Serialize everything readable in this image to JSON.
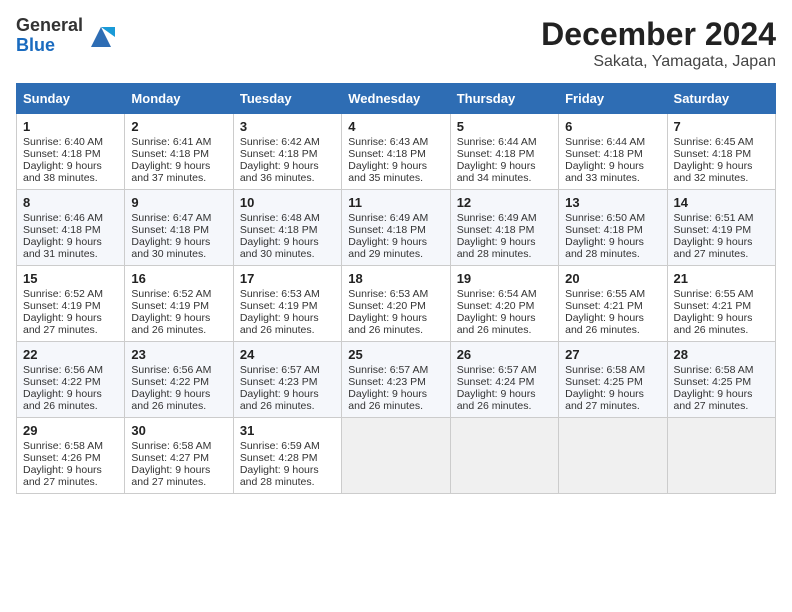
{
  "logo": {
    "general": "General",
    "blue": "Blue"
  },
  "title": "December 2024",
  "subtitle": "Sakata, Yamagata, Japan",
  "weekdays": [
    "Sunday",
    "Monday",
    "Tuesday",
    "Wednesday",
    "Thursday",
    "Friday",
    "Saturday"
  ],
  "weeks": [
    [
      {
        "day": 1,
        "sunrise": "Sunrise: 6:40 AM",
        "sunset": "Sunset: 4:18 PM",
        "daylight": "Daylight: 9 hours and 38 minutes."
      },
      {
        "day": 2,
        "sunrise": "Sunrise: 6:41 AM",
        "sunset": "Sunset: 4:18 PM",
        "daylight": "Daylight: 9 hours and 37 minutes."
      },
      {
        "day": 3,
        "sunrise": "Sunrise: 6:42 AM",
        "sunset": "Sunset: 4:18 PM",
        "daylight": "Daylight: 9 hours and 36 minutes."
      },
      {
        "day": 4,
        "sunrise": "Sunrise: 6:43 AM",
        "sunset": "Sunset: 4:18 PM",
        "daylight": "Daylight: 9 hours and 35 minutes."
      },
      {
        "day": 5,
        "sunrise": "Sunrise: 6:44 AM",
        "sunset": "Sunset: 4:18 PM",
        "daylight": "Daylight: 9 hours and 34 minutes."
      },
      {
        "day": 6,
        "sunrise": "Sunrise: 6:44 AM",
        "sunset": "Sunset: 4:18 PM",
        "daylight": "Daylight: 9 hours and 33 minutes."
      },
      {
        "day": 7,
        "sunrise": "Sunrise: 6:45 AM",
        "sunset": "Sunset: 4:18 PM",
        "daylight": "Daylight: 9 hours and 32 minutes."
      }
    ],
    [
      {
        "day": 8,
        "sunrise": "Sunrise: 6:46 AM",
        "sunset": "Sunset: 4:18 PM",
        "daylight": "Daylight: 9 hours and 31 minutes."
      },
      {
        "day": 9,
        "sunrise": "Sunrise: 6:47 AM",
        "sunset": "Sunset: 4:18 PM",
        "daylight": "Daylight: 9 hours and 30 minutes."
      },
      {
        "day": 10,
        "sunrise": "Sunrise: 6:48 AM",
        "sunset": "Sunset: 4:18 PM",
        "daylight": "Daylight: 9 hours and 30 minutes."
      },
      {
        "day": 11,
        "sunrise": "Sunrise: 6:49 AM",
        "sunset": "Sunset: 4:18 PM",
        "daylight": "Daylight: 9 hours and 29 minutes."
      },
      {
        "day": 12,
        "sunrise": "Sunrise: 6:49 AM",
        "sunset": "Sunset: 4:18 PM",
        "daylight": "Daylight: 9 hours and 28 minutes."
      },
      {
        "day": 13,
        "sunrise": "Sunrise: 6:50 AM",
        "sunset": "Sunset: 4:18 PM",
        "daylight": "Daylight: 9 hours and 28 minutes."
      },
      {
        "day": 14,
        "sunrise": "Sunrise: 6:51 AM",
        "sunset": "Sunset: 4:19 PM",
        "daylight": "Daylight: 9 hours and 27 minutes."
      }
    ],
    [
      {
        "day": 15,
        "sunrise": "Sunrise: 6:52 AM",
        "sunset": "Sunset: 4:19 PM",
        "daylight": "Daylight: 9 hours and 27 minutes."
      },
      {
        "day": 16,
        "sunrise": "Sunrise: 6:52 AM",
        "sunset": "Sunset: 4:19 PM",
        "daylight": "Daylight: 9 hours and 26 minutes."
      },
      {
        "day": 17,
        "sunrise": "Sunrise: 6:53 AM",
        "sunset": "Sunset: 4:19 PM",
        "daylight": "Daylight: 9 hours and 26 minutes."
      },
      {
        "day": 18,
        "sunrise": "Sunrise: 6:53 AM",
        "sunset": "Sunset: 4:20 PM",
        "daylight": "Daylight: 9 hours and 26 minutes."
      },
      {
        "day": 19,
        "sunrise": "Sunrise: 6:54 AM",
        "sunset": "Sunset: 4:20 PM",
        "daylight": "Daylight: 9 hours and 26 minutes."
      },
      {
        "day": 20,
        "sunrise": "Sunrise: 6:55 AM",
        "sunset": "Sunset: 4:21 PM",
        "daylight": "Daylight: 9 hours and 26 minutes."
      },
      {
        "day": 21,
        "sunrise": "Sunrise: 6:55 AM",
        "sunset": "Sunset: 4:21 PM",
        "daylight": "Daylight: 9 hours and 26 minutes."
      }
    ],
    [
      {
        "day": 22,
        "sunrise": "Sunrise: 6:56 AM",
        "sunset": "Sunset: 4:22 PM",
        "daylight": "Daylight: 9 hours and 26 minutes."
      },
      {
        "day": 23,
        "sunrise": "Sunrise: 6:56 AM",
        "sunset": "Sunset: 4:22 PM",
        "daylight": "Daylight: 9 hours and 26 minutes."
      },
      {
        "day": 24,
        "sunrise": "Sunrise: 6:57 AM",
        "sunset": "Sunset: 4:23 PM",
        "daylight": "Daylight: 9 hours and 26 minutes."
      },
      {
        "day": 25,
        "sunrise": "Sunrise: 6:57 AM",
        "sunset": "Sunset: 4:23 PM",
        "daylight": "Daylight: 9 hours and 26 minutes."
      },
      {
        "day": 26,
        "sunrise": "Sunrise: 6:57 AM",
        "sunset": "Sunset: 4:24 PM",
        "daylight": "Daylight: 9 hours and 26 minutes."
      },
      {
        "day": 27,
        "sunrise": "Sunrise: 6:58 AM",
        "sunset": "Sunset: 4:25 PM",
        "daylight": "Daylight: 9 hours and 27 minutes."
      },
      {
        "day": 28,
        "sunrise": "Sunrise: 6:58 AM",
        "sunset": "Sunset: 4:25 PM",
        "daylight": "Daylight: 9 hours and 27 minutes."
      }
    ],
    [
      {
        "day": 29,
        "sunrise": "Sunrise: 6:58 AM",
        "sunset": "Sunset: 4:26 PM",
        "daylight": "Daylight: 9 hours and 27 minutes."
      },
      {
        "day": 30,
        "sunrise": "Sunrise: 6:58 AM",
        "sunset": "Sunset: 4:27 PM",
        "daylight": "Daylight: 9 hours and 27 minutes."
      },
      {
        "day": 31,
        "sunrise": "Sunrise: 6:59 AM",
        "sunset": "Sunset: 4:28 PM",
        "daylight": "Daylight: 9 hours and 28 minutes."
      },
      null,
      null,
      null,
      null
    ]
  ]
}
